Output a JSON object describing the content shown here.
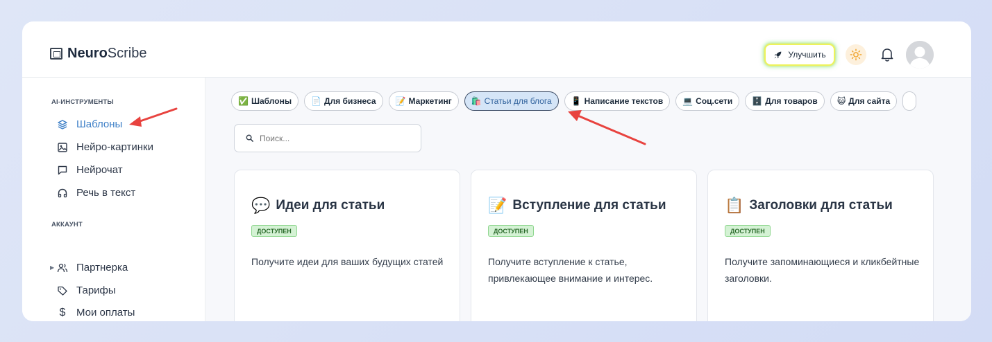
{
  "app": {
    "logo_bold": "Neuro",
    "logo_rest": "Scribe"
  },
  "header": {
    "upgrade_label": "Улучшить"
  },
  "sidebar": {
    "section_tools": "AI-ИНСТРУМЕНТЫ",
    "tools": [
      {
        "label": "Шаблоны",
        "icon": "layers-icon",
        "active": true
      },
      {
        "label": "Нейро-картинки",
        "icon": "image-icon"
      },
      {
        "label": "Нейрочат",
        "icon": "chat-icon"
      },
      {
        "label": "Речь в текст",
        "icon": "headphones-icon"
      }
    ],
    "section_account": "АККАУНТ",
    "account": [
      {
        "label": "Партнерка",
        "icon": "users-icon"
      },
      {
        "label": "Тарифы",
        "icon": "tag-icon"
      },
      {
        "label": "Мои оплаты",
        "icon": "dollar-icon"
      }
    ]
  },
  "chips": [
    {
      "emoji": "✅",
      "label": "Шаблоны"
    },
    {
      "emoji": "📄",
      "label": "Для бизнеса"
    },
    {
      "emoji": "📝",
      "label": "Маркетинг"
    },
    {
      "emoji": "🛍️",
      "label": "Статьи для блога",
      "active": true
    },
    {
      "emoji": "📱",
      "label": "Написание текстов"
    },
    {
      "emoji": "💻",
      "label": "Соц.сети"
    },
    {
      "emoji": "🗄️",
      "label": "Для товаров"
    },
    {
      "emoji": "😺",
      "label": "Для сайта"
    }
  ],
  "search": {
    "placeholder": "Поиск..."
  },
  "cards": [
    {
      "emoji": "💬",
      "title": "Идеи для статьи",
      "badge": "ДОСТУПЕН",
      "desc": "Получите идеи для ваших будущих статей"
    },
    {
      "emoji": "📝",
      "title": "Вступление для статьи",
      "badge": "ДОСТУПЕН",
      "desc": "Получите вступление к статье, привлекающее внимание и интерес."
    },
    {
      "emoji": "📋",
      "title": "Заголовки для статьи",
      "badge": "ДОСТУПЕН",
      "desc": "Получите запоминающиеся и кликбейтные заголовки."
    }
  ],
  "colors": {
    "accent": "#3d7fc7",
    "badge_bg": "#d4f2d4",
    "annotation_arrow": "#e8433f"
  }
}
